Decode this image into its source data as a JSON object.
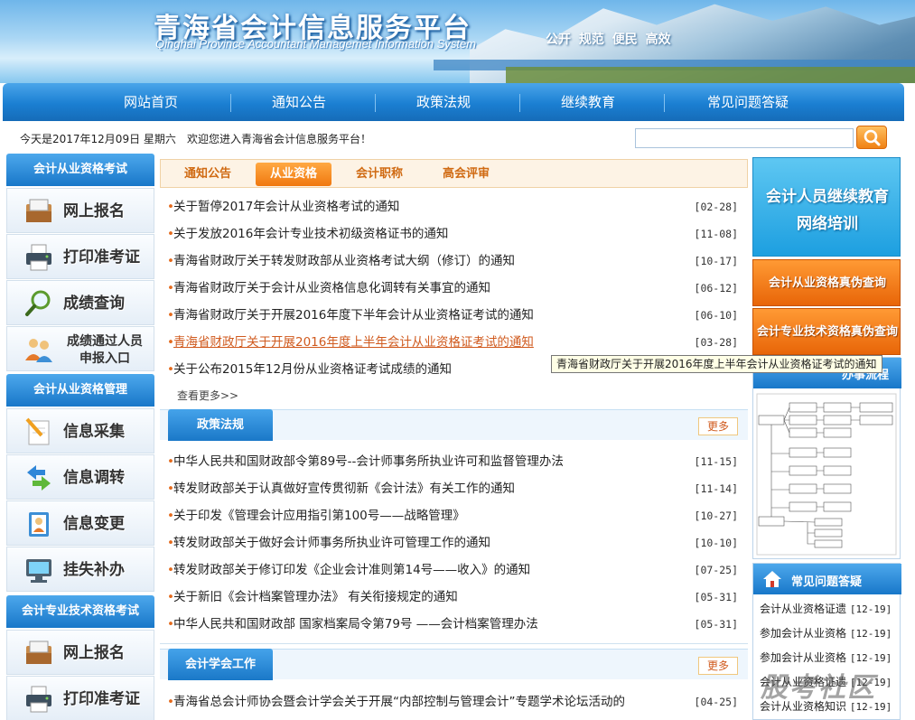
{
  "banner": {
    "title": "青海省会计信息服务平台",
    "subtitle": "Qinghai Province Accountant Managemet Information System",
    "motto": "公开  规范  便民  高效"
  },
  "nav": [
    "网站首页",
    "通知公告",
    "政策法规",
    "继续教育",
    "常见问题答疑"
  ],
  "infobar": {
    "date": "今天是2017年12月09日 星期六",
    "welcome": "欢迎您进入青海省会计信息服务平台！",
    "search_placeholder": ""
  },
  "left": {
    "section1": "会计从业资格考试",
    "section2": "会计从业资格管理",
    "section3": "会计专业技术资格考试",
    "buttons1": [
      "网上报名",
      "打印准考证",
      "成绩查询"
    ],
    "special": [
      "成绩通过人员",
      "申报入口"
    ],
    "buttons2": [
      "信息采集",
      "信息调转",
      "信息变更",
      "挂失补办"
    ],
    "buttons3": [
      "网上报名",
      "打印准考证"
    ]
  },
  "tabs": [
    "通知公告",
    "从业资格",
    "会计职称",
    "高会评审"
  ],
  "news1": [
    {
      "title": "关于暂停2017年会计从业资格考试的通知",
      "date": "[02-28]"
    },
    {
      "title": "关于发放2016年会计专业技术初级资格证书的通知",
      "date": "[11-08]"
    },
    {
      "title": "青海省财政厅关于转发财政部从业资格考试大纲（修订）的通知",
      "date": "[10-17]"
    },
    {
      "title": "青海省财政厅关于会计从业资格信息化调转有关事宜的通知",
      "date": "[06-12]"
    },
    {
      "title": "青海省财政厅关于开展2016年度下半年会计从业资格证考试的通知",
      "date": "[06-10]"
    },
    {
      "title": "青海省财政厅关于开展2016年度上半年会计从业资格证考试的通知",
      "date": "[03-28]"
    },
    {
      "title": "关于公布2015年12月份从业资格证考试成绩的通知",
      "date": ""
    }
  ],
  "more_text": "查看更多>>",
  "tooltip": "青海省财政厅关于开展2016年度上半年会计从业资格证考试的通知",
  "policy": {
    "tab": "政策法规",
    "more": "更多",
    "items": [
      {
        "title": "中华人民共和国财政部令第89号--会计师事务所执业许可和监督管理办法",
        "date": "[11-15]"
      },
      {
        "title": "转发财政部关于认真做好宣传贯彻新《会计法》有关工作的通知",
        "date": "[11-14]"
      },
      {
        "title": "关于印发《管理会计应用指引第100号——战略管理》",
        "date": "[10-27]"
      },
      {
        "title": "转发财政部关于做好会计师事务所执业许可管理工作的通知",
        "date": "[10-10]"
      },
      {
        "title": "转发财政部关于修订印发《企业会计准则第14号——收入》的通知",
        "date": "[07-25]"
      },
      {
        "title": "关于新旧《会计档案管理办法》 有关衔接规定的通知",
        "date": "[05-31]"
      },
      {
        "title": "中华人民共和国财政部 国家档案局令第79号 ——会计档案管理办法",
        "date": "[05-31]"
      }
    ]
  },
  "society": {
    "tab": "会计学会工作",
    "more": "更多",
    "items": [
      {
        "title": "青海省总会计师协会暨会计学会关于开展“内部控制与管理会计”专题学术论坛活动的",
        "date": "[04-25]"
      }
    ]
  },
  "right": {
    "promo1": [
      "会计人员继续教育",
      "网络培训"
    ],
    "promo2": "会计从业资格真伪查询",
    "promo3": "会计专业技术资格真伪查询",
    "flow_title": "办事流程",
    "faq_title": "常见问题答疑",
    "faq": [
      {
        "text": "会计从业资格证遗",
        "date": "[12-19]"
      },
      {
        "text": "参加会计从业资格",
        "date": "[12-19]"
      },
      {
        "text": "参加会计从业资格",
        "date": "[12-19]"
      },
      {
        "text": "会计从业资格证遗",
        "date": "[12-19]"
      },
      {
        "text": "会计从业资格知识",
        "date": "[12-19]"
      }
    ]
  },
  "watermark": "股考社区",
  "colors": {
    "nav_blue": "#1b7fd2",
    "orange": "#f0780f",
    "link_hover": "#d05a1e"
  }
}
